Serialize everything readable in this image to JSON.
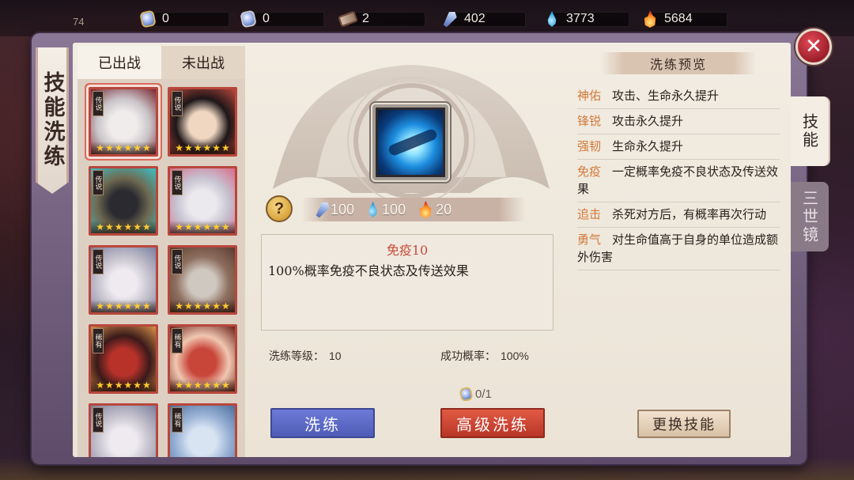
{
  "topbar": {
    "level": "74",
    "resources": [
      {
        "icon": "gold-gem-icon",
        "value": "0"
      },
      {
        "icon": "silver-gem-icon",
        "value": "0"
      },
      {
        "icon": "scroll-icon",
        "value": "2"
      },
      {
        "icon": "crystal-icon",
        "value": "402"
      },
      {
        "icon": "water-drop-icon",
        "value": "3773"
      },
      {
        "icon": "flame-icon",
        "value": "5684"
      }
    ]
  },
  "title": "技能洗练",
  "close_label": "✕",
  "hero_tabs": {
    "deployed": "已出战",
    "undeployed": "未出战"
  },
  "heroes": [
    {
      "badge": "传说",
      "stars": 6,
      "selected": true,
      "palette": [
        "#f1ecec",
        "#c9c4c8",
        "#7a2430"
      ]
    },
    {
      "badge": "传说",
      "stars": 6,
      "selected": false,
      "palette": [
        "#f0d7c2",
        "#1d1618",
        "#b8473c"
      ]
    },
    {
      "badge": "传说",
      "stars": 6,
      "selected": false,
      "palette": [
        "#2a2a30",
        "#6f6a52",
        "#3ac2c8"
      ]
    },
    {
      "badge": "传说",
      "stars": 6,
      "selected": false,
      "palette": [
        "#ece9ee",
        "#c6c2d0",
        "#d96b8a"
      ]
    },
    {
      "badge": "传说",
      "stars": 6,
      "selected": false,
      "palette": [
        "#eeeaf0",
        "#c5c1cc",
        "#7a7fa0"
      ]
    },
    {
      "badge": "传说",
      "stars": 6,
      "selected": false,
      "palette": [
        "#cfc8c0",
        "#8e6f5f",
        "#5b3b2e"
      ]
    },
    {
      "badge": "稀有",
      "stars": 6,
      "selected": false,
      "palette": [
        "#b8322a",
        "#3a1a1a",
        "#d9924a"
      ]
    },
    {
      "badge": "稀有",
      "stars": 6,
      "selected": false,
      "palette": [
        "#c8453a",
        "#f0c7b0",
        "#6a1f1a"
      ]
    },
    {
      "badge": "传说",
      "stars": 6,
      "selected": false,
      "palette": [
        "#eeeaf0",
        "#c5c1cc",
        "#7a7fa0"
      ]
    },
    {
      "badge": "稀有",
      "stars": 6,
      "selected": false,
      "palette": [
        "#d8e4f2",
        "#9ab3d6",
        "#4c6d9c"
      ]
    }
  ],
  "skill": {
    "icon": "blue-orb-skill-icon",
    "help_label": "?",
    "costs": [
      {
        "icon": "crystal-icon",
        "value": "100"
      },
      {
        "icon": "water-drop-icon",
        "value": "100"
      },
      {
        "icon": "flame-icon",
        "value": "20"
      }
    ],
    "name": "免疫10",
    "description": "100%概率免疫不良状态及传送效果",
    "level_label": "洗练等级：",
    "level_value": "10",
    "rate_label": "成功概率：",
    "rate_value": "100%",
    "progress": "0/1"
  },
  "buttons": {
    "refine": "洗练",
    "advanced_refine": "高级洗练",
    "change_skill": "更换技能"
  },
  "preview": {
    "title": "洗练预览",
    "items": [
      {
        "name": "神佑",
        "desc": "攻击、生命永久提升"
      },
      {
        "name": "锋锐",
        "desc": "攻击永久提升"
      },
      {
        "name": "强韧",
        "desc": "生命永久提升"
      },
      {
        "name": "免疫",
        "desc": "一定概率免疫不良状态及传送效果"
      },
      {
        "name": "追击",
        "desc": "杀死对方后，有概率再次行动"
      },
      {
        "name": "勇气",
        "desc": "对生命值高于自身的单位造成额外伤害"
      }
    ]
  },
  "side_tabs": {
    "skill": "技能",
    "mirror": "三世镜"
  },
  "colors": {
    "accent_red": "#c84b3a",
    "accent_blue": "#4f5cb6",
    "name_orange": "#d17a3a"
  }
}
